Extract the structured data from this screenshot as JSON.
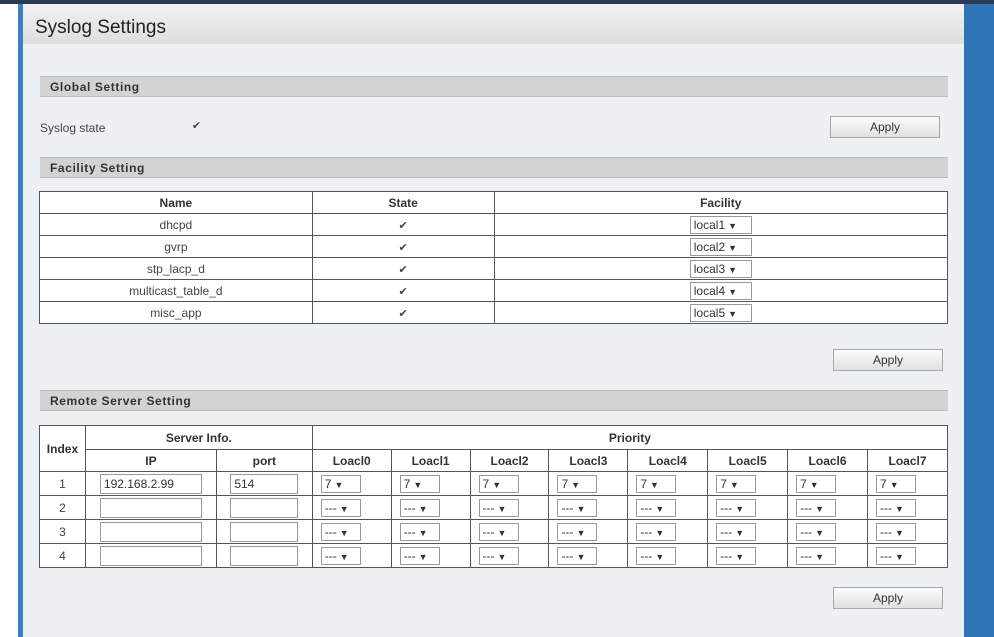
{
  "page": {
    "title": "Syslog Settings"
  },
  "global": {
    "header": "Global Setting",
    "state_label": "Syslog state",
    "state_checked": true,
    "apply_label": "Apply"
  },
  "facility": {
    "header": "Facility Setting",
    "columns": [
      "Name",
      "State",
      "Facility"
    ],
    "rows": [
      {
        "name": "dhcpd",
        "state": true,
        "facility": "local1"
      },
      {
        "name": "gvrp",
        "state": true,
        "facility": "local2"
      },
      {
        "name": "stp_lacp_d",
        "state": true,
        "facility": "local3"
      },
      {
        "name": "multicast_table_d",
        "state": true,
        "facility": "local4"
      },
      {
        "name": "misc_app",
        "state": true,
        "facility": "local5"
      }
    ],
    "apply_label": "Apply"
  },
  "remote": {
    "header": "Remote Server Setting",
    "col_index": "Index",
    "col_server_info": "Server Info.",
    "col_priority": "Priority",
    "col_ip": "IP",
    "col_port": "port",
    "priority_cols": [
      "Loacl0",
      "Loacl1",
      "Loacl2",
      "Loacl3",
      "Loacl4",
      "Loacl5",
      "Loacl6",
      "Loacl7"
    ],
    "rows": [
      {
        "index": "1",
        "ip": "192.168.2.99",
        "port": "514",
        "priorities": [
          "7",
          "7",
          "7",
          "7",
          "7",
          "7",
          "7",
          "7"
        ]
      },
      {
        "index": "2",
        "ip": "",
        "port": "",
        "priorities": [
          "---",
          "---",
          "---",
          "---",
          "---",
          "---",
          "---",
          "---"
        ]
      },
      {
        "index": "3",
        "ip": "",
        "port": "",
        "priorities": [
          "---",
          "---",
          "---",
          "---",
          "---",
          "---",
          "---",
          "---"
        ]
      },
      {
        "index": "4",
        "ip": "",
        "port": "",
        "priorities": [
          "---",
          "---",
          "---",
          "---",
          "---",
          "---",
          "---",
          "---"
        ]
      }
    ],
    "apply_label": "Apply"
  },
  "icons": {
    "check": "check-icon",
    "dropdown": "chevron-down-icon"
  },
  "colors": {
    "accent": "#2f74b6",
    "section_bg": "#d3d3d3",
    "panel_bg": "#eef1f4"
  }
}
